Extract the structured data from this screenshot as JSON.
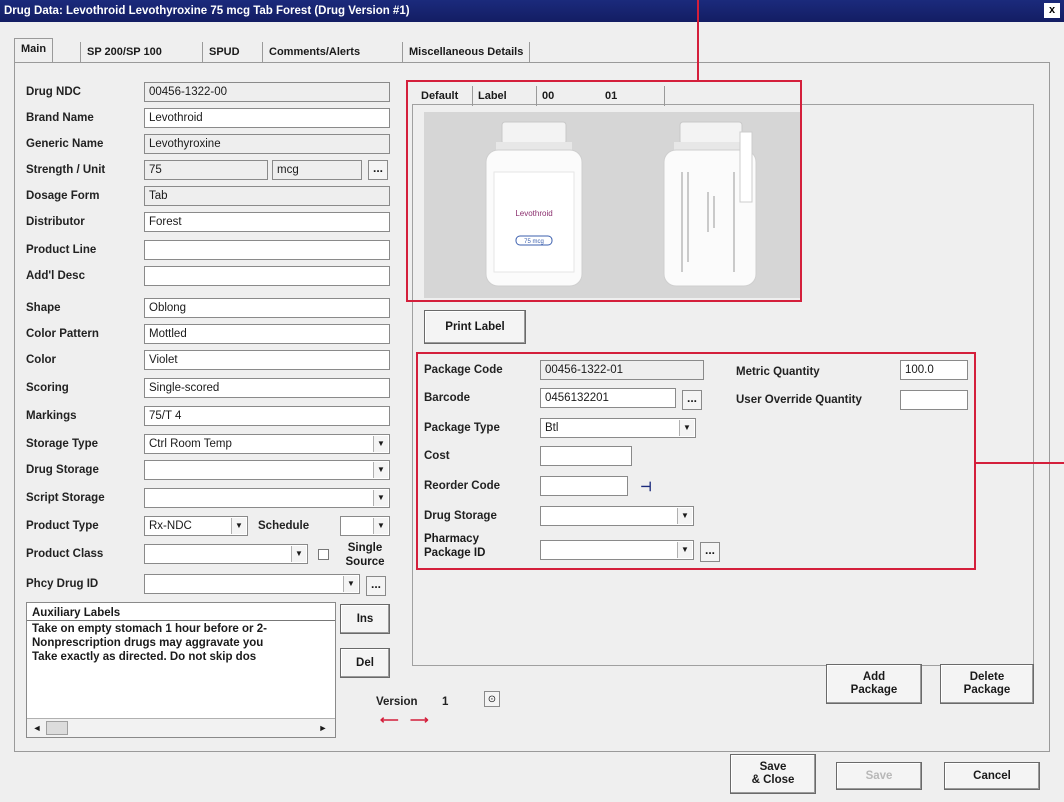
{
  "window": {
    "title": "Drug Data: Levothroid Levothyroxine 75 mcg Tab Forest  (Drug Version #1)",
    "close_label": "x"
  },
  "tabs": [
    "Main",
    "SP 200/SP 100",
    "SPUD",
    "Comments/Alerts",
    "Miscellaneous Details"
  ],
  "fields": {
    "drug_ndc": {
      "label": "Drug NDC",
      "value": "00456-1322-00"
    },
    "brand_name": {
      "label": "Brand Name",
      "value": "Levothroid"
    },
    "generic_name": {
      "label": "Generic Name",
      "value": "Levothyroxine"
    },
    "strength": {
      "label": "Strength / Unit",
      "value": "75",
      "unit": "mcg"
    },
    "dosage_form": {
      "label": "Dosage Form",
      "value": "Tab"
    },
    "distributor": {
      "label": "Distributor",
      "value": "Forest"
    },
    "product_line": {
      "label": "Product Line",
      "value": ""
    },
    "addl_desc": {
      "label": "Add'l Desc",
      "value": ""
    },
    "shape": {
      "label": "Shape",
      "value": "Oblong"
    },
    "color_pattern": {
      "label": "Color Pattern",
      "value": "Mottled"
    },
    "color": {
      "label": "Color",
      "value": "Violet"
    },
    "scoring": {
      "label": "Scoring",
      "value": "Single-scored"
    },
    "markings": {
      "label": "Markings",
      "value": "75/T 4"
    },
    "storage_type": {
      "label": "Storage Type",
      "value": "Ctrl Room Temp"
    },
    "drug_storage": {
      "label": "Drug Storage",
      "value": ""
    },
    "script_storage": {
      "label": "Script Storage",
      "value": ""
    },
    "product_type": {
      "label": "Product Type",
      "value": "Rx-NDC"
    },
    "schedule": {
      "label": "Schedule",
      "value": ""
    },
    "product_class": {
      "label": "Product Class",
      "value": ""
    },
    "single_source": {
      "label": "Single Source"
    },
    "phcy_drug_id": {
      "label": "Phcy Drug ID",
      "value": ""
    }
  },
  "auxiliary": {
    "header": "Auxiliary Labels",
    "lines": [
      "Take on empty stomach 1 hour before or 2-",
      "Nonprescription drugs may aggravate you",
      "Take exactly as directed.  Do not skip dos"
    ],
    "ins_label": "Ins",
    "del_label": "Del"
  },
  "version": {
    "label": "Version",
    "value": "1"
  },
  "image_tabs": [
    "Default",
    "Label",
    "00",
    "01"
  ],
  "bottle_text": "Levothroid",
  "bottle_dose": "75 mcg",
  "print_label": "Print Label",
  "package": {
    "code": {
      "label": "Package Code",
      "value": "00456-1322-01"
    },
    "barcode": {
      "label": "Barcode",
      "value": "0456132201"
    },
    "type": {
      "label": "Package Type",
      "value": "Btl"
    },
    "cost": {
      "label": "Cost",
      "value": ""
    },
    "reorder": {
      "label": "Reorder Code",
      "value": ""
    },
    "drug_storage": {
      "label": "Drug Storage",
      "value": ""
    },
    "pharmacy_id": {
      "label1": "Pharmacy",
      "label2": "Package ID",
      "value": ""
    },
    "metric_qty": {
      "label": "Metric Quantity",
      "value": "100.0"
    },
    "user_override": {
      "label": "User Override Quantity",
      "value": ""
    }
  },
  "buttons": {
    "add_package_1": "Add",
    "add_package_2": "Package",
    "delete_package_1": "Delete",
    "delete_package_2": "Package",
    "save_close_1": "Save",
    "save_close_2": "& Close",
    "save": "Save",
    "cancel": "Cancel"
  },
  "ellipsis": "...",
  "dropdown_glyph": "▼",
  "colors": {
    "highlight": "#d41f3b",
    "titlebar": "#1b2a7c"
  }
}
